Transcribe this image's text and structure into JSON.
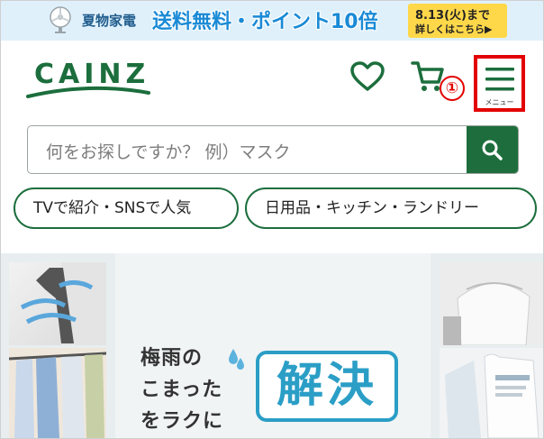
{
  "banner": {
    "small_text": "夏物家電",
    "main_text": "送料無料・ポイント10倍",
    "date_text": "8.13(火)まで",
    "more_text": "詳しくはこちら▶"
  },
  "header": {
    "logo_text": "CAINZ",
    "step_marker": "①",
    "menu_label": "メニュー"
  },
  "search": {
    "placeholder": "何をお探しですか？ 例）マスク"
  },
  "categories": [
    {
      "label": "TVで紹介・SNSで人気"
    },
    {
      "label": "日用品・キッチン・ランドリー"
    }
  ],
  "hero": {
    "lines": [
      "梅雨の",
      "こまった",
      "をラクに"
    ],
    "highlight": "解決"
  },
  "colors": {
    "brand_green": "#1c6e3d",
    "highlight_red": "#e30000",
    "hero_blue": "#2b9ec6",
    "badge_yellow": "#ffd84a"
  }
}
